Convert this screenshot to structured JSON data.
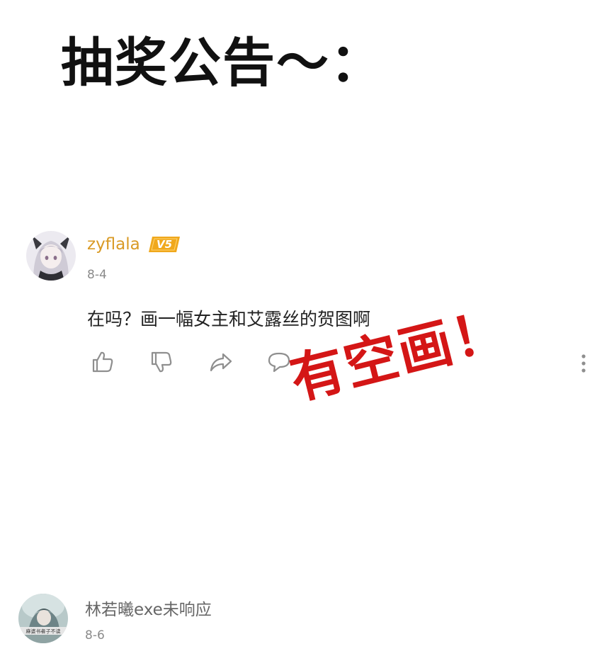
{
  "headline": "抽奖公告～：",
  "comments": [
    {
      "username": "zyflala",
      "badge": "V5",
      "date": "8-4",
      "content": "在吗？画一幅女主和艾露丝的贺图啊"
    },
    {
      "username": "林若曦exe未响应",
      "date": "8-6",
      "avatar_caption": "麻婆书者子不读"
    }
  ],
  "stamp": "有空画！",
  "actions": {
    "like_icon": "thumbs-up-icon",
    "dislike_icon": "thumbs-down-icon",
    "share_icon": "share-icon",
    "reply_icon": "speech-bubble-icon",
    "more_icon": "more-vertical-icon"
  },
  "colors": {
    "username_vip": "#d99a25",
    "badge": "#f0a81c",
    "date": "#8a8a8a",
    "icon": "#8f8f8f",
    "stamp": "#d41616"
  }
}
